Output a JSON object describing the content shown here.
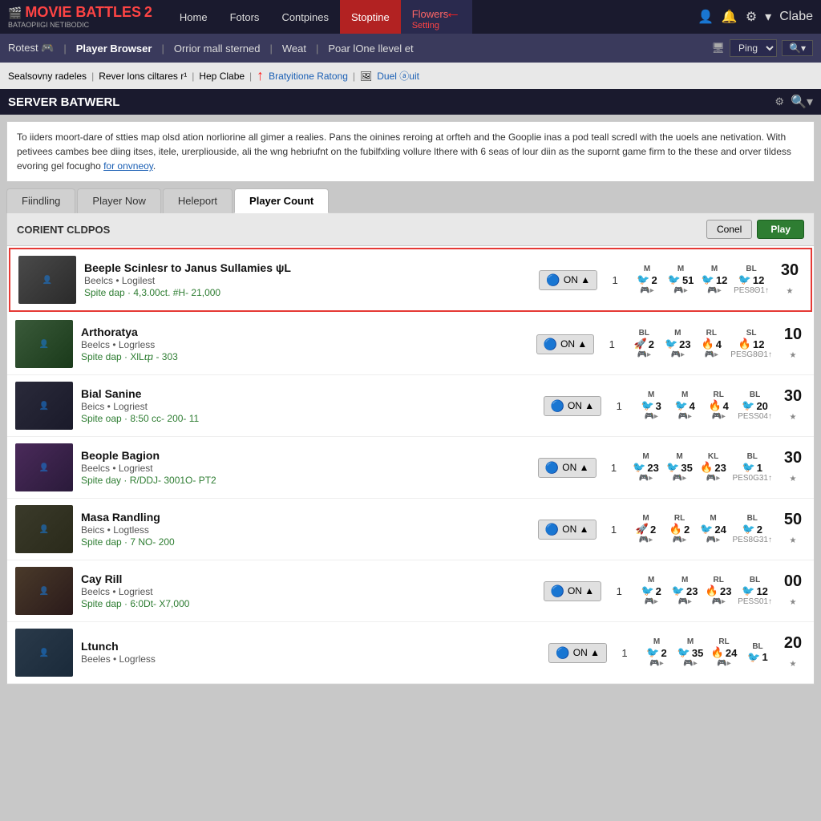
{
  "topnav": {
    "logo": "MOVIE BATTLES",
    "logo_num": "2",
    "logo_sub": "BATAOPIIGI NETIBODIC",
    "items": [
      {
        "label": "Home",
        "active": false
      },
      {
        "label": "Fotors",
        "active": false
      },
      {
        "label": "Contpines",
        "active": false
      },
      {
        "label": "Stoptine",
        "active": false
      },
      {
        "label": "Flowers",
        "active": true,
        "sub": "Setting"
      }
    ],
    "right": [
      "👤",
      "🔔",
      "⚙",
      "▾",
      "Clabe"
    ]
  },
  "secnav": {
    "items": [
      {
        "label": "Rotest 🎮"
      },
      {
        "label": "Player Browser"
      },
      {
        "label": "Orrior mall sterned"
      },
      {
        "label": "Weat"
      },
      {
        "label": "Poar lOne llevel et"
      }
    ],
    "filter": {
      "options": [
        "Ping"
      ],
      "btn": "🔍▾"
    }
  },
  "breadcrumb": {
    "items": [
      {
        "label": "Sealsovny radeles",
        "link": false
      },
      {
        "label": "Rever lons ciltares r¹",
        "link": false
      },
      {
        "label": "Hep Clabe",
        "link": false
      },
      {
        "label": "Bratyitione Ratong",
        "link": true
      },
      {
        "label": "Duel ⓐuit",
        "link": true
      }
    ]
  },
  "server_panel": {
    "title": "SERVER BATWERL"
  },
  "description": "To iiders moort-dare of stties map olsd ation norliorine all gimer a realies. Pans the oinines reroing at orfteh and the Gooplie inas a pod teall scredl with the uoels ane netivation. With petivees cambes bee diing itses, itele, urerpliouside, ali the wng hebriufnt on the fubilfxling vollure lthere with 6 seas of lour diin as the supornt game firm to the these and orver tildess evoring gel focugho",
  "desc_link": "for onvneoy",
  "tabs": [
    {
      "label": "Fiindling",
      "active": false
    },
    {
      "label": "Player Now",
      "active": false
    },
    {
      "label": "Heleport",
      "active": false
    },
    {
      "label": "Player Count",
      "active": true
    }
  ],
  "list": {
    "title": "CORIENT Cldpos",
    "btn_conel": "Conel",
    "btn_play": "Play"
  },
  "servers": [
    {
      "id": 1,
      "selected": true,
      "thumb_class": "thumb-1",
      "name": "Beeple Scinlesr to Janus Sullamies ψL",
      "tags": "Beelcs • Logilest",
      "map": "Spite dap · 4,3.00ct. #H- 21,000",
      "status": "ON ▲",
      "num": "1",
      "stats": [
        {
          "label": "M",
          "val": "2",
          "icon": "🐦",
          "sub": "🎮▸"
        },
        {
          "label": "M",
          "val": "51",
          "icon": "🐦",
          "sub": "🎮▸"
        },
        {
          "label": "M",
          "val": "12",
          "icon": "🐦",
          "sub": "🎮▸"
        },
        {
          "label": "BL",
          "val": "12",
          "icon": "🐦",
          "sub": "PES8Θ1↑"
        }
      ],
      "total": "30"
    },
    {
      "id": 2,
      "selected": false,
      "thumb_class": "thumb-2",
      "name": "Arthoratya",
      "tags": "Beelcs • Logrless",
      "map": "Spite dap · XlLⴔ - 303",
      "status": "ON ▲",
      "num": "1",
      "stats": [
        {
          "label": "BL",
          "val": "2",
          "icon": "🚀",
          "sub": "🎮▸"
        },
        {
          "label": "M",
          "val": "23",
          "icon": "🐦",
          "sub": "🎮▸"
        },
        {
          "label": "RL",
          "val": "4",
          "icon": "🔥",
          "sub": "🎮▸"
        },
        {
          "label": "SL",
          "val": "12",
          "icon": "🔥",
          "sub": "PESG8Θ1↑"
        }
      ],
      "total": "10"
    },
    {
      "id": 3,
      "selected": false,
      "thumb_class": "thumb-3",
      "name": "Bial Sanine",
      "tags": "Beics • Logriest",
      "map": "Spite oap · 8:50 cc- 200- 11",
      "status": "ON ▲",
      "num": "1",
      "stats": [
        {
          "label": "M",
          "val": "3",
          "icon": "🐦",
          "sub": "🎮▸"
        },
        {
          "label": "M",
          "val": "4",
          "icon": "🐦",
          "sub": "🎮▸"
        },
        {
          "label": "RL",
          "val": "4",
          "icon": "🔥",
          "sub": "🎮▸"
        },
        {
          "label": "BL",
          "val": "20",
          "icon": "🐦",
          "sub": "PESS04↑"
        }
      ],
      "total": "30"
    },
    {
      "id": 4,
      "selected": false,
      "thumb_class": "thumb-4",
      "name": "Beople Bagion",
      "tags": "Beelcs • Logriest",
      "map": "Spite day · R/DDJ- 3001O- PT2",
      "status": "ON ▲",
      "num": "1",
      "stats": [
        {
          "label": "M",
          "val": "23",
          "icon": "🐦",
          "sub": "🎮▸"
        },
        {
          "label": "M",
          "val": "35",
          "icon": "🐦",
          "sub": "🎮▸"
        },
        {
          "label": "KL",
          "val": "23",
          "icon": "🔥",
          "sub": "🎮▸"
        },
        {
          "label": "BL",
          "val": "1",
          "icon": "🐦",
          "sub": "PES0G31↑"
        }
      ],
      "total": "30"
    },
    {
      "id": 5,
      "selected": false,
      "thumb_class": "thumb-5",
      "name": "Masa Randling",
      "tags": "Beics • Logtless",
      "map": "Spite dap · 7 NO- 200",
      "status": "ON ▲",
      "num": "1",
      "stats": [
        {
          "label": "M",
          "val": "2",
          "icon": "🚀",
          "sub": "🎮▸"
        },
        {
          "label": "RL",
          "val": "2",
          "icon": "🔥",
          "sub": "🎮▸"
        },
        {
          "label": "M",
          "val": "24",
          "icon": "🐦",
          "sub": "🎮▸"
        },
        {
          "label": "BL",
          "val": "2",
          "icon": "🐦",
          "sub": "PES8G31↑"
        }
      ],
      "total": "50"
    },
    {
      "id": 6,
      "selected": false,
      "thumb_class": "thumb-6",
      "name": "Cay Rill",
      "tags": "Beelcs • Logriest",
      "map": "Spite dap · 6:0Dt- X7,000",
      "status": "ON ▲",
      "num": "1",
      "stats": [
        {
          "label": "M",
          "val": "2",
          "icon": "🐦",
          "sub": "🎮▸"
        },
        {
          "label": "M",
          "val": "23",
          "icon": "🐦",
          "sub": "🎮▸"
        },
        {
          "label": "RL",
          "val": "23",
          "icon": "🔥",
          "sub": "🎮▸"
        },
        {
          "label": "BL",
          "val": "12",
          "icon": "🐦",
          "sub": "PESS01↑"
        }
      ],
      "total": "00"
    },
    {
      "id": 7,
      "selected": false,
      "thumb_class": "thumb-7",
      "name": "Ltunch",
      "tags": "Beeles • Logrless",
      "map": "",
      "status": "ON ▲",
      "num": "1",
      "stats": [
        {
          "label": "M",
          "val": "2",
          "icon": "🐦",
          "sub": "🎮▸"
        },
        {
          "label": "M",
          "val": "35",
          "icon": "🐦",
          "sub": "🎮▸"
        },
        {
          "label": "RL",
          "val": "24",
          "icon": "🔥",
          "sub": "🎮▸"
        },
        {
          "label": "BL",
          "val": "1",
          "icon": "🐦",
          "sub": ""
        }
      ],
      "total": "20"
    }
  ]
}
